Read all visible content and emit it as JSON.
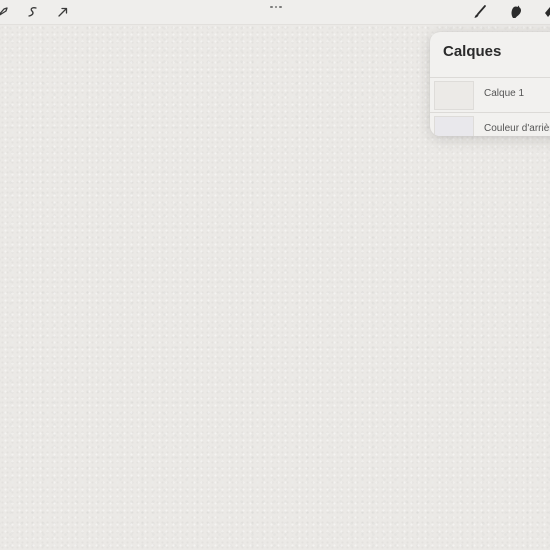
{
  "toolbar": {
    "left_icons": [
      "adjustments-icon",
      "selection-icon",
      "transform-icon"
    ],
    "more_icon": "more-dots-icon",
    "right_icons": [
      "brush-icon",
      "smudge-icon",
      "eraser-icon"
    ]
  },
  "layers_panel": {
    "title": "Calques",
    "layers": [
      {
        "name": "Calque 1"
      },
      {
        "name": "Couleur d'arrière"
      }
    ]
  },
  "colors": {
    "canvas": "#ebe9e6",
    "toolbar": "#efeeec",
    "panel": "#f2f1ef",
    "icon": "#3a3a3a"
  }
}
